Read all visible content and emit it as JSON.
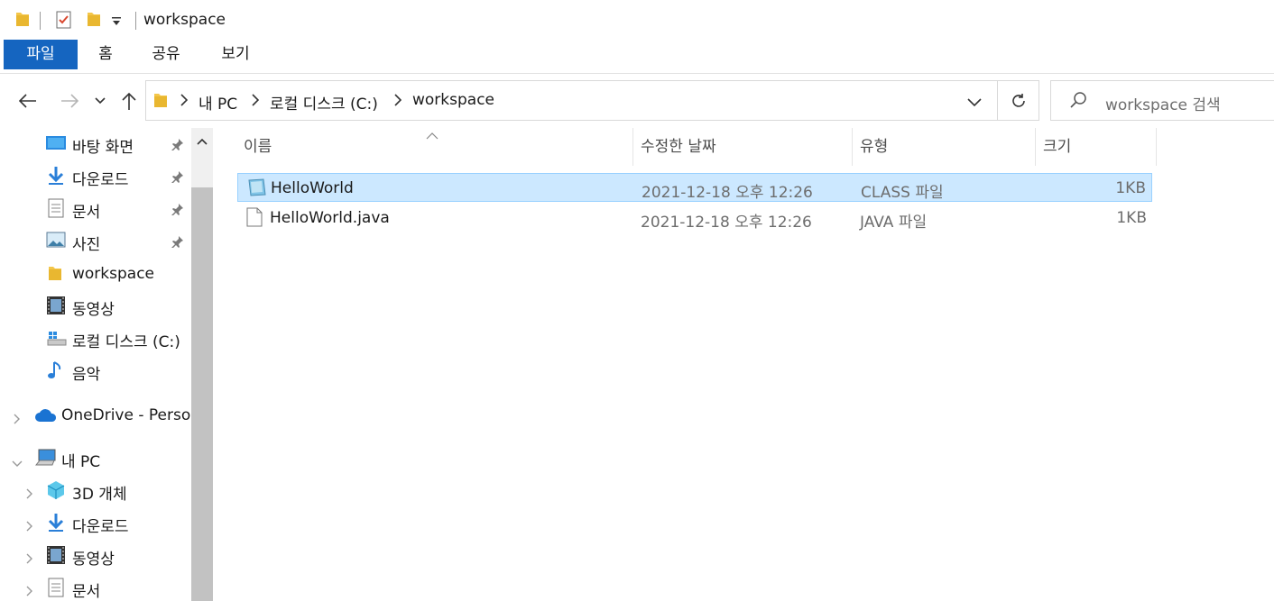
{
  "window": {
    "title": "workspace"
  },
  "ribbon": {
    "tabs": [
      "파일",
      "홈",
      "공유",
      "보기"
    ]
  },
  "address": {
    "crumbs": [
      "내 PC",
      "로컬 디스크 (C:)",
      "workspace"
    ]
  },
  "search": {
    "placeholder": "workspace 검색"
  },
  "nav": {
    "quick": [
      {
        "label": "바탕 화면",
        "icon": "desktop-icon",
        "pinned": true
      },
      {
        "label": "다운로드",
        "icon": "download-icon",
        "pinned": true
      },
      {
        "label": "문서",
        "icon": "documents-icon",
        "pinned": true
      },
      {
        "label": "사진",
        "icon": "pictures-icon",
        "pinned": true
      },
      {
        "label": "workspace",
        "icon": "folder-icon",
        "pinned": false
      },
      {
        "label": "동영상",
        "icon": "video-icon",
        "pinned": false
      },
      {
        "label": "로컬 디스크 (C:)",
        "icon": "drive-icon",
        "pinned": false
      },
      {
        "label": "음악",
        "icon": "music-icon",
        "pinned": false
      }
    ],
    "onedrive": "OneDrive - Persor",
    "thispc": "내 PC",
    "pc_children": [
      "3D 개체",
      "다운로드",
      "동영상",
      "문서"
    ]
  },
  "columns": {
    "name": "이름",
    "date": "수정한 날짜",
    "type": "유형",
    "size": "크기"
  },
  "files": [
    {
      "name": "HelloWorld",
      "date": "2021-12-18 오후 12:26",
      "type": "CLASS 파일",
      "size": "1KB",
      "selected": true
    },
    {
      "name": "HelloWorld.java",
      "date": "2021-12-18 오후 12:26",
      "type": "JAVA 파일",
      "size": "1KB",
      "selected": false
    }
  ],
  "colors": {
    "accent": "#1565c0",
    "selection": "#cce8ff",
    "folder": "#f3c64a"
  }
}
